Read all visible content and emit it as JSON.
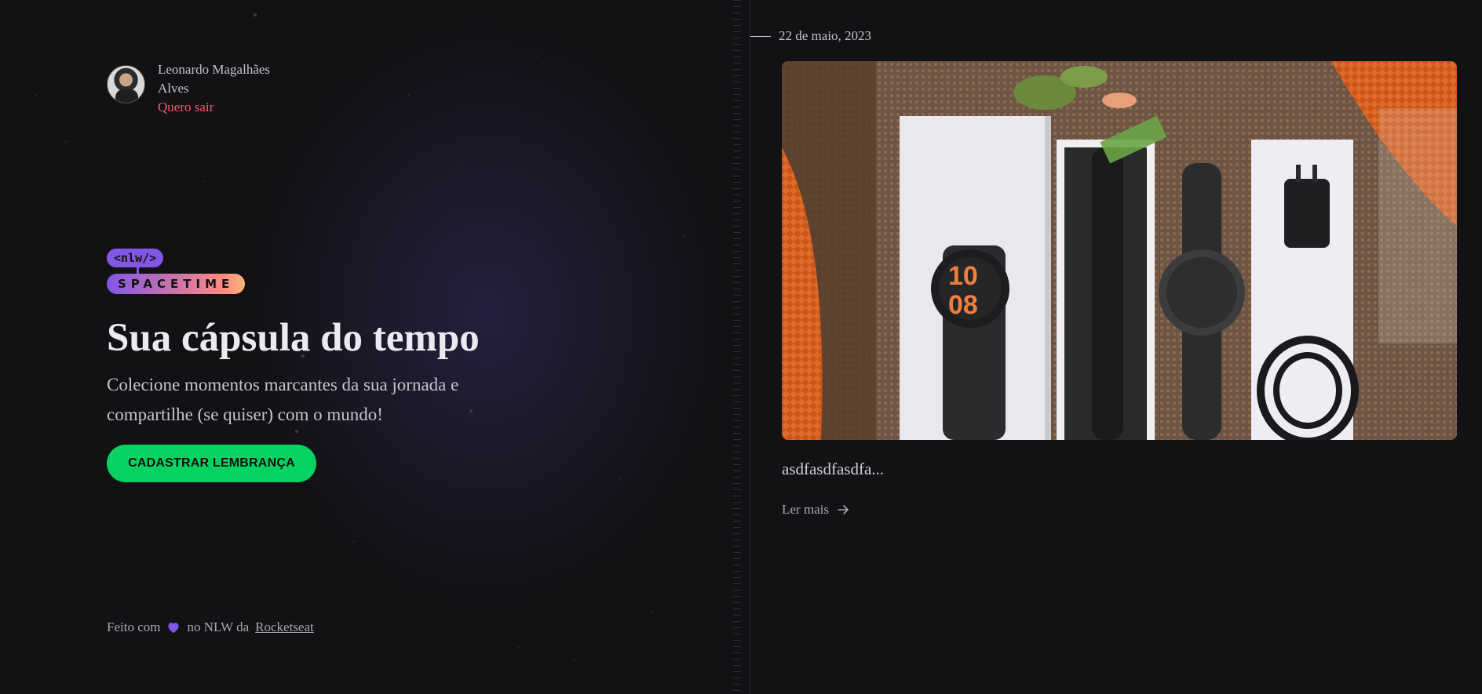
{
  "user": {
    "name": "Leonardo Magalhães Alves",
    "logout_label": "Quero sair"
  },
  "logo": {
    "top_text": "<nlw/>",
    "bottom_text": "SPACETIME"
  },
  "hero": {
    "title": "Sua cápsula do tempo",
    "description": "Colecione momentos marcantes da sua jornada e compartilhe (se quiser) com o mundo!",
    "cta_label": "Cadastrar lembrança"
  },
  "footer": {
    "prefix": "Feito com",
    "middle": "no NLW da",
    "link_label": "Rocketseat"
  },
  "memory": {
    "date": "22 de maio, 2023",
    "excerpt": "asdfasdfasdfa...",
    "read_more_label": "Ler mais"
  },
  "colors": {
    "accent_green": "#04d361",
    "accent_purple": "#8257e5",
    "logout_red": "#f75a68"
  }
}
